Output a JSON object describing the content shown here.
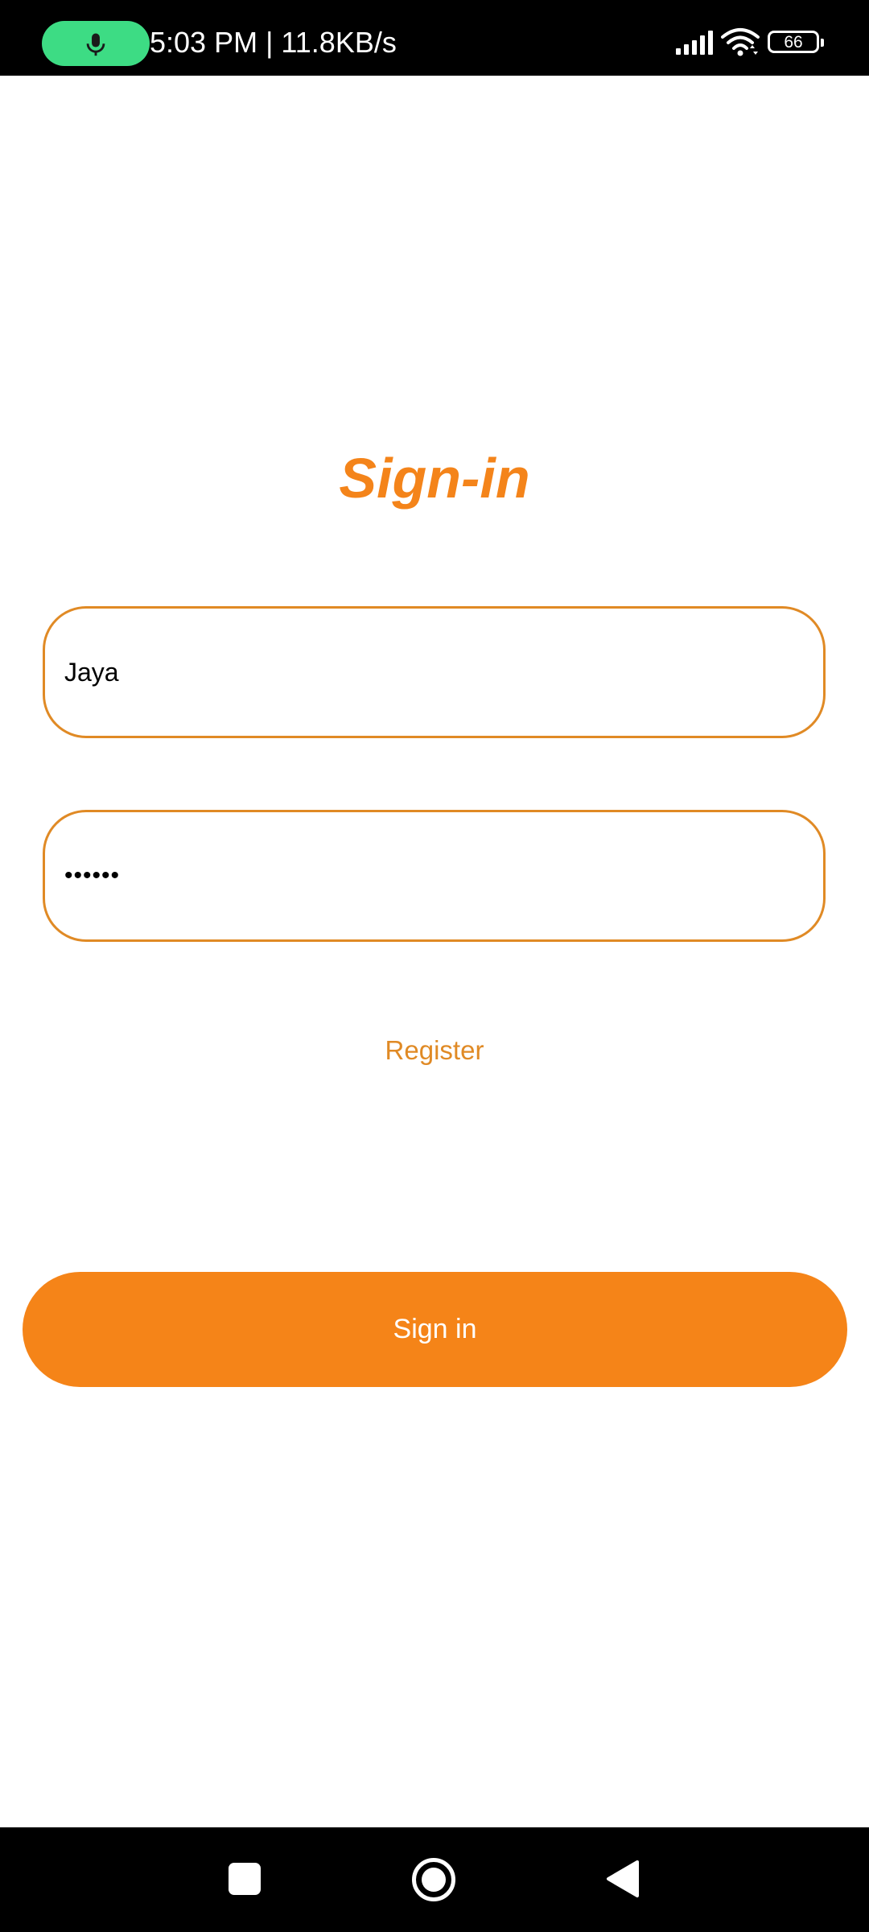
{
  "status_bar": {
    "time_speed": "5:03 PM | 11.8KB/s",
    "battery_level": "66",
    "icons": [
      "mic-icon",
      "signal-icon",
      "wifi-icon",
      "battery-icon"
    ]
  },
  "page": {
    "title": "Sign-in"
  },
  "form": {
    "username_value": "Jaya",
    "password_value": "••••••",
    "register_label": "Register",
    "signin_label": "Sign in"
  },
  "nav_bar": {
    "icons": [
      "recents-icon",
      "home-icon",
      "back-icon"
    ]
  },
  "colors": {
    "accent": "#f58418",
    "field_border": "#e08a25",
    "mic_pill": "#3ddc84",
    "bars": "#000000"
  }
}
